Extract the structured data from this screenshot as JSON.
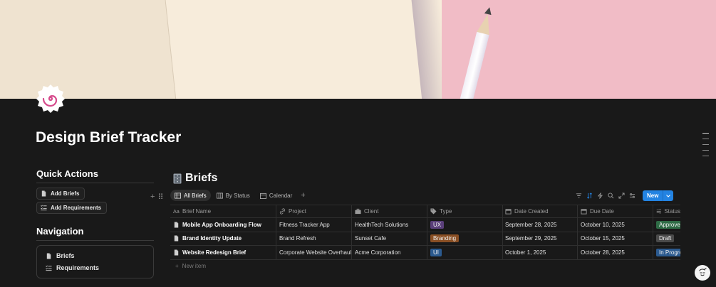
{
  "page": {
    "title": "Design Brief Tracker"
  },
  "quick_actions": {
    "title": "Quick Actions",
    "buttons": [
      {
        "label": "Add Briefs",
        "icon": "document-icon"
      },
      {
        "label": "Add Requirements",
        "icon": "checklist-icon"
      }
    ]
  },
  "navigation": {
    "title": "Navigation",
    "items": [
      {
        "label": "Briefs",
        "icon": "document-icon"
      },
      {
        "label": "Requirements",
        "icon": "checklist-icon"
      }
    ]
  },
  "database": {
    "title": "Briefs",
    "icon": "filing-cabinet-icon",
    "views": [
      {
        "label": "All Briefs",
        "icon": "table-icon",
        "active": true
      },
      {
        "label": "By Status",
        "icon": "board-icon",
        "active": false
      },
      {
        "label": "Calendar",
        "icon": "calendar-icon",
        "active": false
      }
    ],
    "toolbar": {
      "new_label": "New"
    },
    "columns": [
      {
        "label": "Brief Name",
        "icon": "text-icon"
      },
      {
        "label": "Project",
        "icon": "relation-icon"
      },
      {
        "label": "Client",
        "icon": "briefcase-icon"
      },
      {
        "label": "Type",
        "icon": "tag-icon"
      },
      {
        "label": "Date Created",
        "icon": "calendar-icon"
      },
      {
        "label": "Due Date",
        "icon": "calendar-icon"
      },
      {
        "label": "Status",
        "icon": "status-icon"
      }
    ],
    "rows": [
      {
        "name": "Mobile App Onboarding Flow",
        "project": "Fitness Tracker App",
        "client": "HealthTech Solutions",
        "type": "UX",
        "created": "September 28, 2025",
        "due": "October 10, 2025",
        "status": "Approved"
      },
      {
        "name": "Brand Identity Update",
        "project": "Brand Refresh",
        "client": "Sunset Cafe",
        "type": "Branding",
        "created": "September 29, 2025",
        "due": "October 15, 2025",
        "status": "Draft"
      },
      {
        "name": "Website Redesign Brief",
        "project": "Corporate Website Overhaul",
        "client": "Acme Corporation",
        "type": "UI",
        "created": "October 1, 2025",
        "due": "October 28, 2025",
        "status": "In Progress"
      }
    ],
    "new_item_label": "New item"
  },
  "colors": {
    "tag_ux": "#5a3f7a",
    "tag_branding": "#8a4f24",
    "tag_ui": "#2b5a8f",
    "status_approved": "#2e6b45",
    "status_draft": "#4a4a4a",
    "status_in_progress": "#2b5a8f",
    "accent": "#2383e2"
  }
}
